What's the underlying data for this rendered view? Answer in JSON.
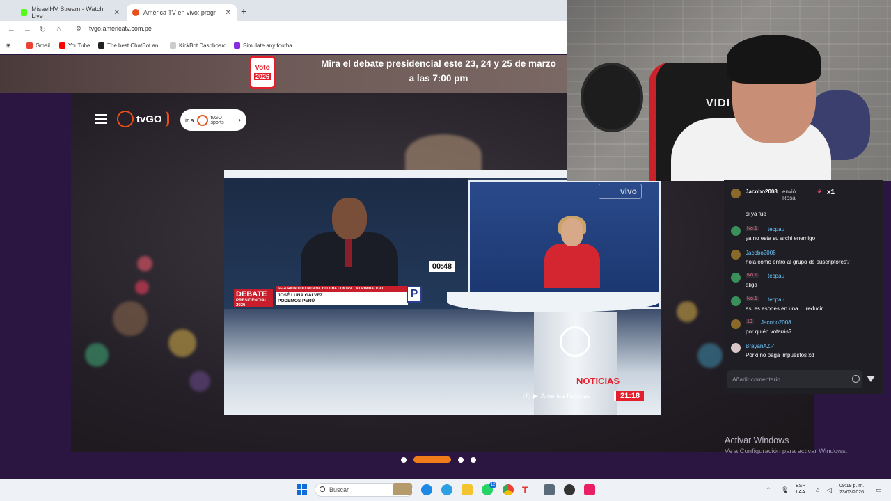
{
  "browser": {
    "tabs": [
      {
        "label": "MisaelHV Stream - Watch Live",
        "color": "#53fc18"
      },
      {
        "label": "América TV en vivo: progr",
        "color": "#e94e1b"
      }
    ],
    "url": "tvgo.americatv.com.pe",
    "bookmarks": [
      {
        "label": "Gmail",
        "color": "#ea4335"
      },
      {
        "label": "YouTube",
        "color": "#ff0000"
      },
      {
        "label": "The best ChatBot an...",
        "color": "#222222"
      },
      {
        "label": "KickBot Dashboard",
        "color": "#cccccc"
      },
      {
        "label": "Simulate any footba...",
        "color": "#8a2be2"
      }
    ]
  },
  "banner": {
    "badge_top": "Voto",
    "badge_year": "2026",
    "line1": "Mira el debate presidencial este 23, 24 y 25 de marzo",
    "line2": "a las 7:00 pm"
  },
  "site": {
    "logo": "tvGO",
    "ira_label": "ir a",
    "ira_brand_line1": "tvGO",
    "ira_brand_line2": "sports"
  },
  "video": {
    "timer": "00:48",
    "debate_title": "DEBATE",
    "debate_sub": "PRESIDENCIAL",
    "debate_year": "2026",
    "topic": "SEGURIDAD CIUDADANA Y LUCHA CONTRA LA CRIMINALIDAD",
    "candidate": "JOSÉ LUNA GÁLVEZ",
    "party": "PODEMOS PERÚ",
    "party_letter": "P",
    "live_label": "vivo",
    "brand_prefix": "",
    "brand": "NOTICIAS",
    "social": "América Noticias",
    "time": "21:18"
  },
  "carousel": {
    "count": 4,
    "active": 1
  },
  "webcam": {
    "chair_text": "VIDI"
  },
  "chat": {
    "gift": {
      "user": "Jacobo2008",
      "action": "envió Rosa",
      "count": "x1"
    },
    "messages": [
      {
        "user": "",
        "badge": "",
        "text": "si ya fue",
        "avatar": "",
        "name_color": "#ffffff"
      },
      {
        "user": "tecpau",
        "badge": "No.1",
        "text": "ya no esta su archi enemigo",
        "avatar": "#3a8f5a",
        "name_color": "#6cc6ff"
      },
      {
        "user": "Jacobo2008",
        "badge": "",
        "text": "hola como entro al grupo de suscriptores?",
        "avatar": "#8a6a2a",
        "name_color": "#6cc6ff"
      },
      {
        "user": "tecpau",
        "badge": "No.1",
        "text": "aliga",
        "avatar": "#3a8f5a",
        "name_color": "#6cc6ff"
      },
      {
        "user": "tecpau",
        "badge": "No.1",
        "text": "asi es esones en una.... reducir",
        "avatar": "#3a8f5a",
        "name_color": "#6cc6ff"
      },
      {
        "user": "Jacobo2008",
        "badge": "10",
        "text": "por quién votarás?",
        "avatar": "#8a6a2a",
        "name_color": "#6cc6ff"
      },
      {
        "user": "BrayanAZ✓",
        "badge": "",
        "text": "Porki no paga impuestos xd",
        "avatar": "#d9c7c7",
        "name_color": "#6cc6ff"
      }
    ],
    "input_placeholder": "Añadir comentario"
  },
  "windows": {
    "activate_title": "Activar Windows",
    "activate_sub": "Ve a Configuración para activar Windows."
  },
  "taskbar": {
    "search_placeholder": "Buscar",
    "whatsapp_badge": "12",
    "lang_line1": "ESP",
    "lang_line2": "LAA",
    "time": "09:19 p. m.",
    "date": "23/03/2026"
  }
}
